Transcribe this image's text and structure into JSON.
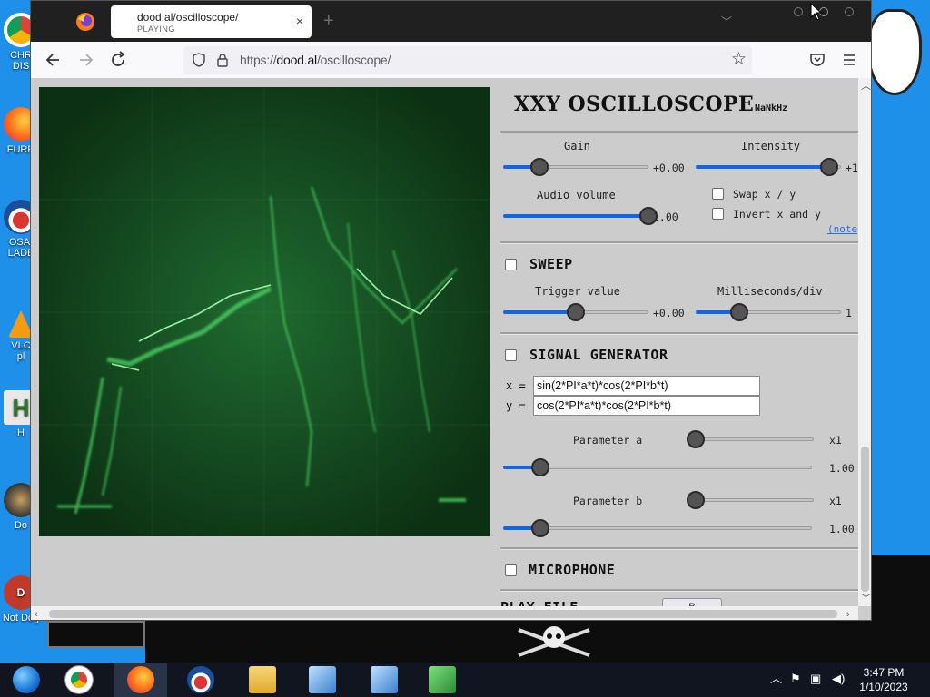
{
  "desktop": {
    "icons": [
      {
        "label": "CHR\nDIS",
        "color": "#e04a3a"
      },
      {
        "label": "FURR",
        "color": "#f08a1a"
      },
      {
        "label": "OSAI\nLADE",
        "color": "#2b5fb0"
      },
      {
        "label": "VLC\npl",
        "color": "#f39c12"
      },
      {
        "label": "H",
        "color": "#2a7a2a"
      },
      {
        "label": "Do",
        "color": "#333"
      },
      {
        "label": "Not Dog",
        "color": "#c0392b"
      }
    ]
  },
  "browser": {
    "tab": {
      "title": "dood.al/oscilloscope/",
      "status": "PLAYING",
      "close": "×"
    },
    "new_tab": "+",
    "tab_list": "﹀",
    "url": {
      "scheme": "https://",
      "host": "dood.al",
      "path": "/oscilloscope/"
    },
    "icons": {
      "back": "back-arrow-icon",
      "forward": "forward-arrow-icon",
      "reload": "reload-icon",
      "shield": "shield-icon",
      "lock": "lock-icon",
      "star": "star-icon",
      "pocket": "pocket-icon",
      "menu": "hamburger-menu-icon"
    }
  },
  "panel": {
    "title": "XXY OSCILLOSCOPE",
    "freq": "NaNkHz",
    "gain": {
      "label": "Gain",
      "value_text": "+0.00",
      "fraction": 0.25
    },
    "intensity": {
      "label": "Intensity",
      "value_text": "+1",
      "fraction": 0.92
    },
    "audio_volume": {
      "label": "Audio volume",
      "value_text": "1.00",
      "fraction": 1.0
    },
    "swap_xy": {
      "label": "Swap x / y",
      "checked": false
    },
    "invert_xy": {
      "label": "Invert x and y",
      "checked": false
    },
    "note_link": "(note",
    "sweep": {
      "label": "SWEEP",
      "checked": false,
      "trigger": {
        "label": "Trigger value",
        "value_text": "+0.00",
        "fraction": 0.5
      },
      "ms_div": {
        "label": "Milliseconds/div",
        "value_text": "1",
        "fraction": 0.3
      }
    },
    "signal_generator": {
      "label": "SIGNAL GENERATOR",
      "checked": false,
      "x_label": "x =",
      "x_expr": "sin(2*PI*a*t)*cos(2*PI*b*t)",
      "y_label": "y =",
      "y_expr": "cos(2*PI*a*t)*cos(2*PI*b*t)",
      "param_a": {
        "label": "Parameter a",
        "mult_text": "x1",
        "mult_fraction": 0.0,
        "value_text": "1.00",
        "fraction": 0.12
      },
      "param_b": {
        "label": "Parameter b",
        "mult_text": "x1",
        "mult_fraction": 0.0,
        "value_text": "1.00",
        "fraction": 0.12
      }
    },
    "microphone": {
      "label": "MICROPHONE",
      "checked": false
    },
    "play_file": {
      "label": "PLAY FILE",
      "button": "B"
    }
  },
  "taskbar": {
    "items": [
      {
        "name": "ie-task",
        "color": "#1b74d6"
      },
      {
        "name": "chrome-task",
        "color": "#dd4433"
      },
      {
        "name": "firefox-task",
        "color": "#ff7a1a"
      },
      {
        "name": "obama-task",
        "color": "#d33"
      },
      {
        "name": "explorer-task",
        "color": "#f2c24f"
      },
      {
        "name": "installer-task",
        "color": "#6aa9e8"
      },
      {
        "name": "installer2-task",
        "color": "#6aa9e8"
      },
      {
        "name": "network-task",
        "color": "#3aa55a"
      }
    ],
    "time": "3:47 PM",
    "date": "1/10/2023"
  },
  "colors": {
    "accent": "#1565e0",
    "scope_bg": "#0e3814",
    "trace": "#5df07a"
  }
}
